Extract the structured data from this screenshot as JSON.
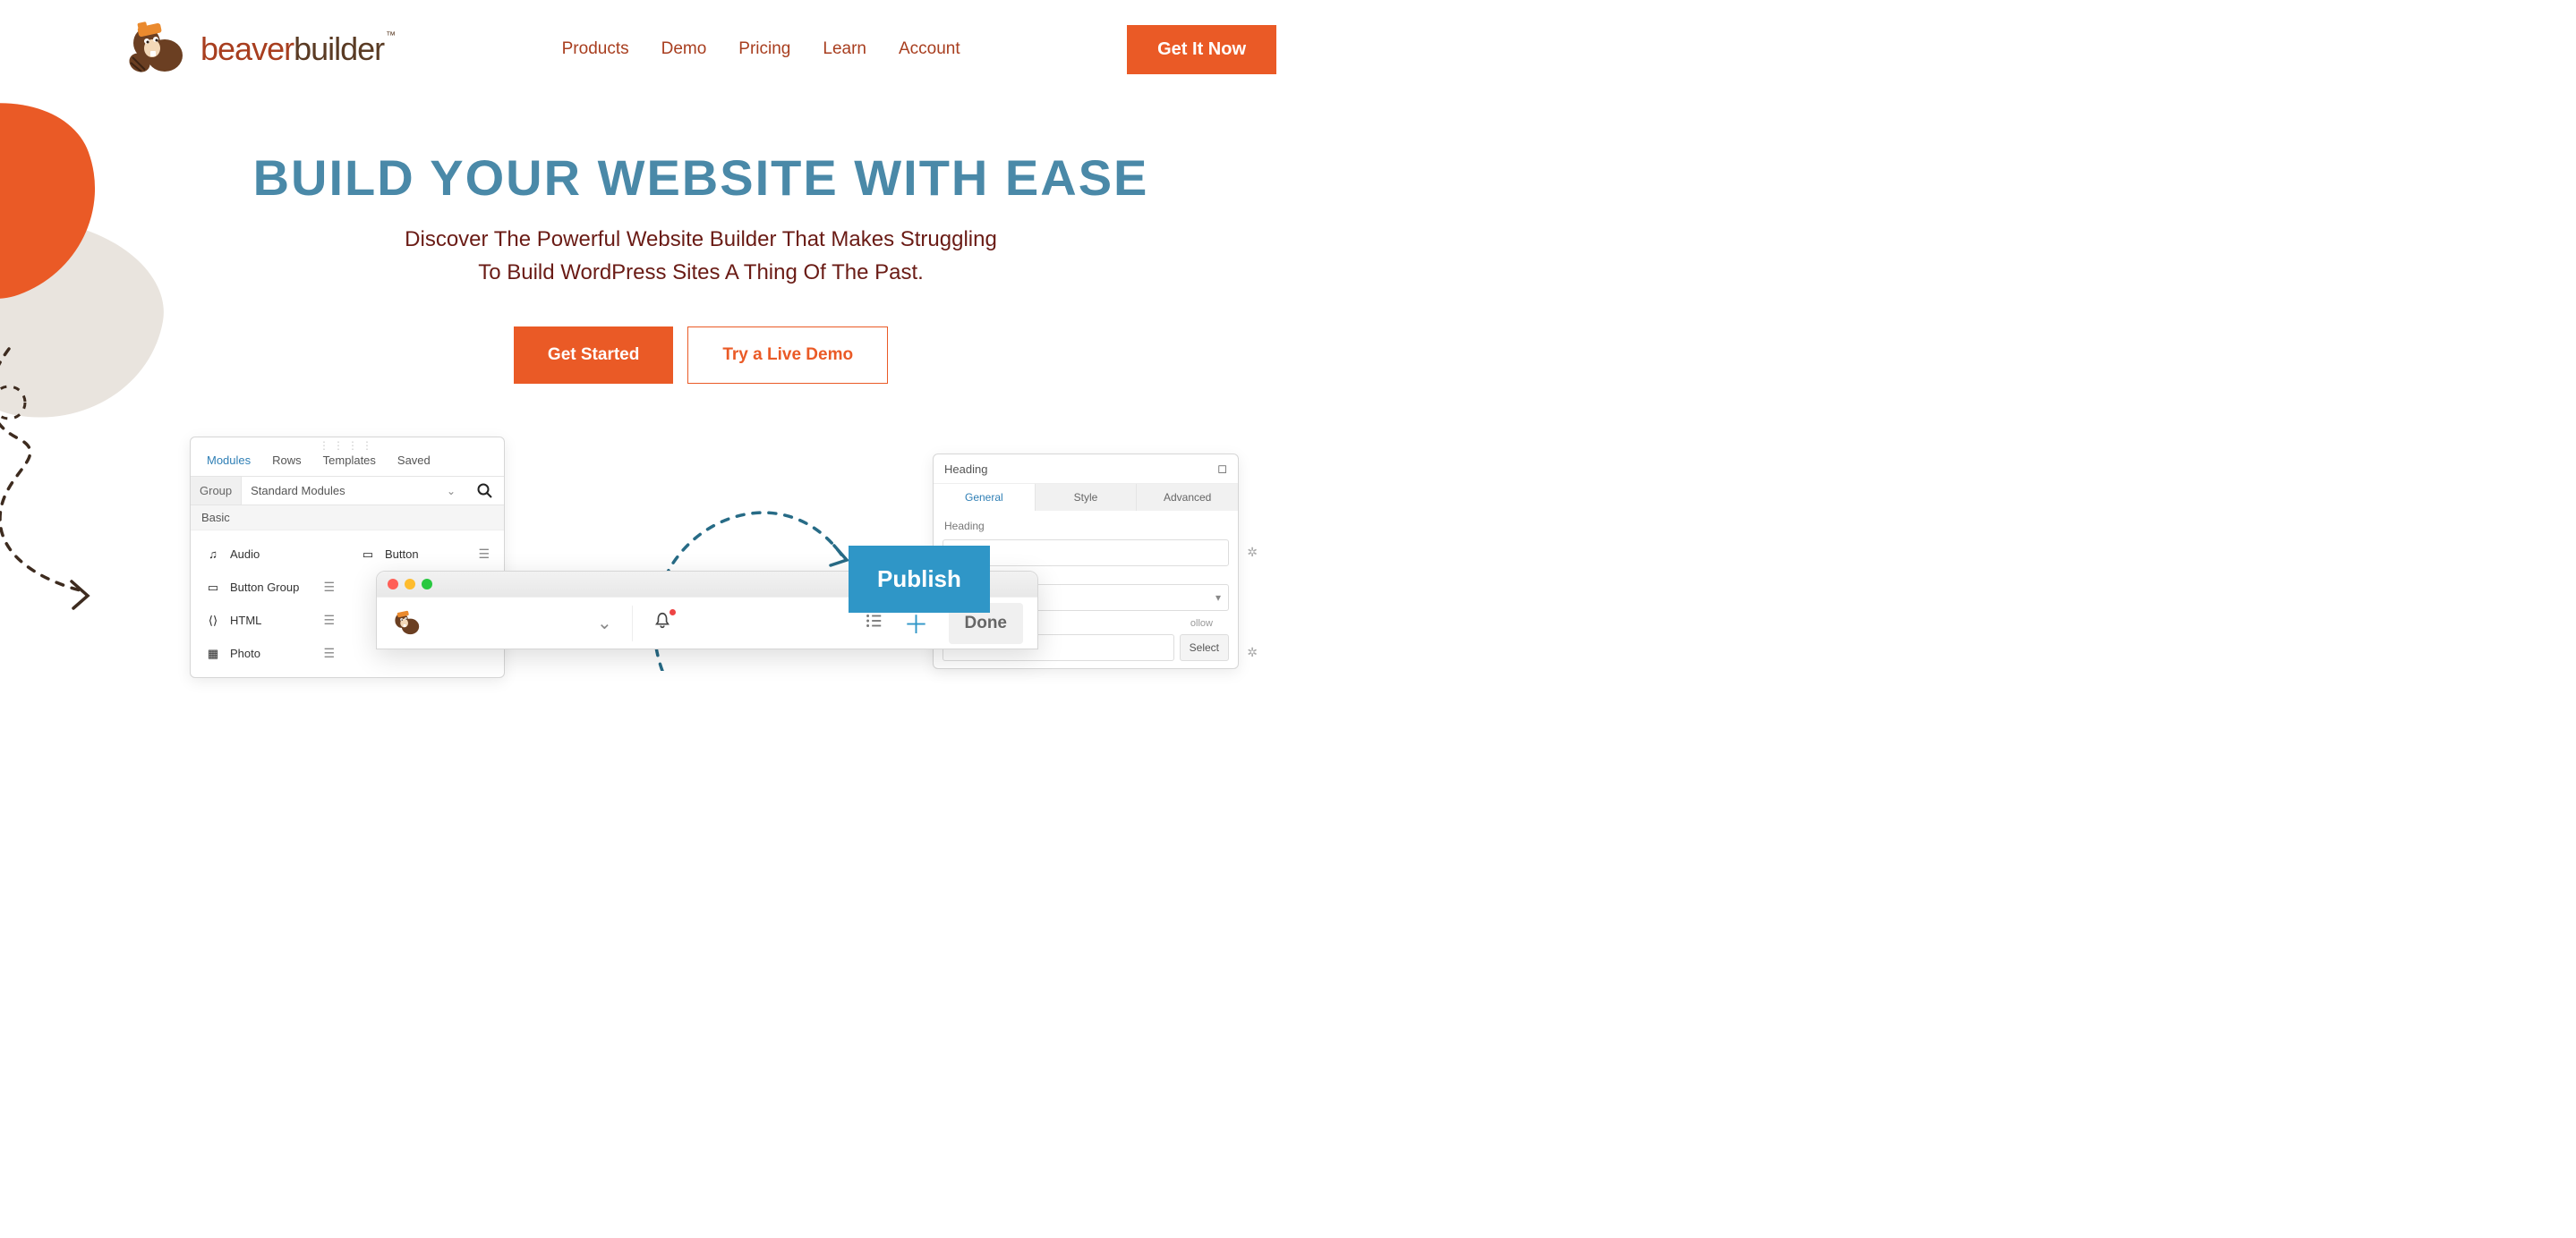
{
  "brand": {
    "bold": "beaver",
    "thin": "builder"
  },
  "nav": {
    "items": [
      "Products",
      "Demo",
      "Pricing",
      "Learn",
      "Account"
    ]
  },
  "cta": "Get It Now",
  "hero": {
    "title": "BUILD YOUR WEBSITE WITH EASE",
    "subtitle": "Discover The Powerful Website Builder That Makes Struggling To Build WordPress Sites A Thing Of The Past.",
    "primary": "Get Started",
    "secondary": "Try a Live Demo"
  },
  "panel_left": {
    "tabs": [
      "Modules",
      "Rows",
      "Templates",
      "Saved"
    ],
    "active_tab": 0,
    "group_label": "Group",
    "group_value": "Standard Modules",
    "section": "Basic",
    "modules": [
      {
        "icon": "♫",
        "label": "Audio"
      },
      {
        "icon": "▭",
        "label": "Button"
      },
      {
        "icon": "▭",
        "label": "Button Group"
      },
      {
        "icon": "⟨⟩",
        "label": "HTML"
      },
      {
        "icon": "▦",
        "label": "Photo"
      }
    ]
  },
  "panel_right": {
    "title": "Heading",
    "tabs": [
      "General",
      "Style",
      "Advanced"
    ],
    "active_tab": 0,
    "field_label": "Heading",
    "select_btn": "Select",
    "chevron": "▾"
  },
  "publish": "Publish",
  "browser": {
    "done": "Done"
  },
  "follow_text": "ollow"
}
